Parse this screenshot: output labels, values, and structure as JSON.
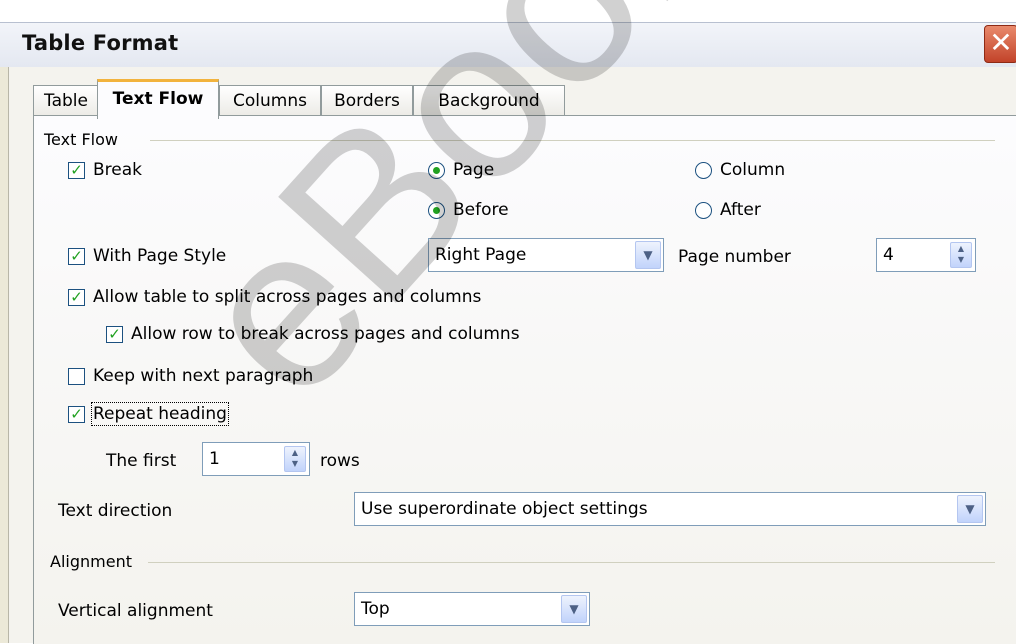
{
  "window": {
    "title": "Table Format",
    "close_label": "✕"
  },
  "tabs": [
    {
      "label": "Table"
    },
    {
      "label": "Text Flow",
      "active": true
    },
    {
      "label": "Columns"
    },
    {
      "label": "Borders"
    },
    {
      "label": "Background"
    }
  ],
  "text_flow": {
    "group_title": "Text Flow",
    "break": {
      "label": "Break",
      "checked": true
    },
    "page": {
      "label": "Page",
      "selected": true
    },
    "column": {
      "label": "Column",
      "selected": false
    },
    "before": {
      "label": "Before",
      "selected": true
    },
    "after": {
      "label": "After",
      "selected": false
    },
    "with_page_style": {
      "label": "With Page Style",
      "checked": true
    },
    "page_style_value": "Right Page",
    "page_number_label": "Page number",
    "page_number_value": "4",
    "allow_split": {
      "label": "Allow table to split across pages and columns",
      "checked": true
    },
    "allow_row_break": {
      "label": "Allow row to break across pages and columns",
      "checked": true
    },
    "keep_next": {
      "label": "Keep with next paragraph",
      "checked": false
    },
    "repeat_heading": {
      "label": "Repeat heading",
      "checked": true
    },
    "the_first_label": "The first",
    "the_first_value": "1",
    "rows_label": "rows",
    "text_direction_label": "Text direction",
    "text_direction_value": "Use superordinate object settings"
  },
  "alignment": {
    "group_title": "Alignment",
    "vertical_label": "Vertical alignment",
    "vertical_value": "Top"
  },
  "watermark": "eBook Edit",
  "icons": {
    "check": "✓",
    "dropdown": "▼",
    "spin_up": "▲",
    "spin_down": "▼"
  }
}
